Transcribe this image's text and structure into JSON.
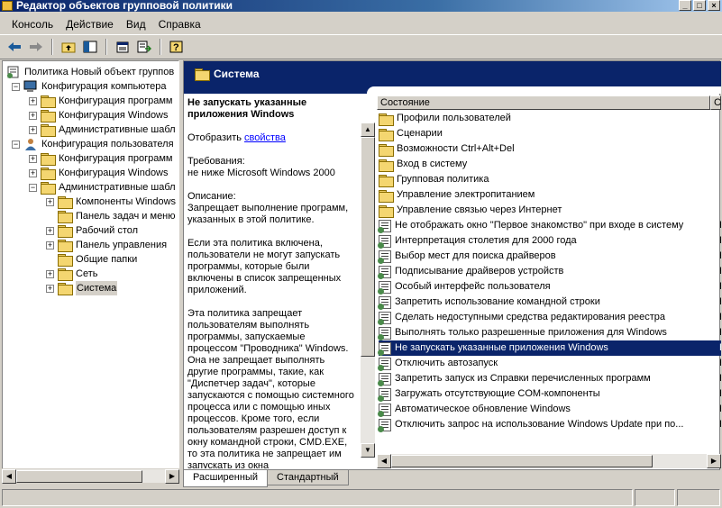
{
  "window": {
    "title": "Редактор объектов групповой политики"
  },
  "menu": [
    "Консоль",
    "Действие",
    "Вид",
    "Справка"
  ],
  "toolbar": {
    "icons": [
      "back-arrow-icon",
      "forward-arrow-icon",
      "up-folder-icon",
      "show-hide-tree-icon",
      "properties-icon",
      "export-list-icon",
      "help-icon"
    ]
  },
  "tree": [
    {
      "label": "Политика Новый объект группов",
      "level": 0,
      "exp": "",
      "icon": "policy"
    },
    {
      "label": "Конфигурация компьютера",
      "level": 1,
      "exp": "-",
      "icon": "computer"
    },
    {
      "label": "Конфигурация программ",
      "level": 2,
      "exp": "+",
      "icon": "folder"
    },
    {
      "label": "Конфигурация Windows",
      "level": 2,
      "exp": "+",
      "icon": "folder"
    },
    {
      "label": "Административные шабл",
      "level": 2,
      "exp": "+",
      "icon": "folder"
    },
    {
      "label": "Конфигурация пользователя",
      "level": 1,
      "exp": "-",
      "icon": "user"
    },
    {
      "label": "Конфигурация программ",
      "level": 2,
      "exp": "+",
      "icon": "folder"
    },
    {
      "label": "Конфигурация Windows",
      "level": 2,
      "exp": "+",
      "icon": "folder"
    },
    {
      "label": "Административные шабл",
      "level": 2,
      "exp": "-",
      "icon": "folder"
    },
    {
      "label": "Компоненты Windows",
      "level": 3,
      "exp": "+",
      "icon": "folder"
    },
    {
      "label": "Панель задач и меню",
      "level": 3,
      "exp": "",
      "icon": "folder"
    },
    {
      "label": "Рабочий стол",
      "level": 3,
      "exp": "+",
      "icon": "folder"
    },
    {
      "label": "Панель управления",
      "level": 3,
      "exp": "+",
      "icon": "folder"
    },
    {
      "label": "Общие папки",
      "level": 3,
      "exp": "",
      "icon": "folder"
    },
    {
      "label": "Сеть",
      "level": 3,
      "exp": "+",
      "icon": "folder"
    },
    {
      "label": "Система",
      "level": 3,
      "exp": "+",
      "icon": "folder",
      "selected": true
    }
  ],
  "pane": {
    "header": "Система"
  },
  "description": {
    "title": "Не запускать указанные приложения Windows",
    "show": "Отобразить",
    "link": "свойства",
    "requirements_label": "Требования:",
    "requirements": "не ниже Microsoft Windows 2000",
    "desc_label": "Описание:",
    "desc1": "Запрещает выполнение программ, указанных в этой политике.",
    "desc2": "Если эта политика включена, пользователи не могут запускать программы, которые были включены в список запрещенных приложений.",
    "desc3": "Эта политика запрещает пользователям выполнять программы, запускаемые процессом \"Проводника\" Windows. Она не запрещает выполнять другие программы, такие, как \"Диспетчер задач\", которые запускаются с помощью системного процесса или с помощью иных процессов. Кроме того, если пользователям разрешен доступ к окну командной строки, CMD.EXE, то эта политика не запрещает им запускать из окна"
  },
  "columns": {
    "setting": "Состояние",
    "state": "С"
  },
  "settings": [
    {
      "label": "Профили пользователей",
      "type": "folder",
      "state": ""
    },
    {
      "label": "Сценарии",
      "type": "folder",
      "state": ""
    },
    {
      "label": "Возможности Ctrl+Alt+Del",
      "type": "folder",
      "state": ""
    },
    {
      "label": "Вход в систему",
      "type": "folder",
      "state": ""
    },
    {
      "label": "Групповая политика",
      "type": "folder",
      "state": ""
    },
    {
      "label": "Управление электропитанием",
      "type": "folder",
      "state": ""
    },
    {
      "label": "Управление связью через Интернет",
      "type": "folder",
      "state": ""
    },
    {
      "label": "Не отображать окно \"Первое знакомство\" при входе в систему",
      "type": "policy",
      "state": "Н"
    },
    {
      "label": "Интерпретация столетия для 2000 года",
      "type": "policy",
      "state": "Н"
    },
    {
      "label": "Выбор мест для поиска драйверов",
      "type": "policy",
      "state": "Н"
    },
    {
      "label": "Подписывание драйверов устройств",
      "type": "policy",
      "state": "Н"
    },
    {
      "label": "Особый интерфейс пользователя",
      "type": "policy",
      "state": "Н"
    },
    {
      "label": "Запретить использование командной строки",
      "type": "policy",
      "state": "Н"
    },
    {
      "label": "Сделать недоступными средства редактирования реестра",
      "type": "policy",
      "state": "Н"
    },
    {
      "label": "Выполнять только разрешенные приложения для Windows",
      "type": "policy",
      "state": "Н"
    },
    {
      "label": "Не запускать указанные приложения Windows",
      "type": "policy",
      "state": "Н",
      "selected": true
    },
    {
      "label": "Отключить автозапуск",
      "type": "policy",
      "state": "Н"
    },
    {
      "label": "Запретить запуск из Справки перечисленных программ",
      "type": "policy",
      "state": "Н"
    },
    {
      "label": "Загружать отсутствующие COM-компоненты",
      "type": "policy",
      "state": "Н"
    },
    {
      "label": "Автоматическое обновление Windows",
      "type": "policy",
      "state": "Н"
    },
    {
      "label": "Отключить запрос на использование Windows Update при по...",
      "type": "policy",
      "state": "Н"
    }
  ],
  "tabs": [
    "Расширенный",
    "Стандартный"
  ]
}
